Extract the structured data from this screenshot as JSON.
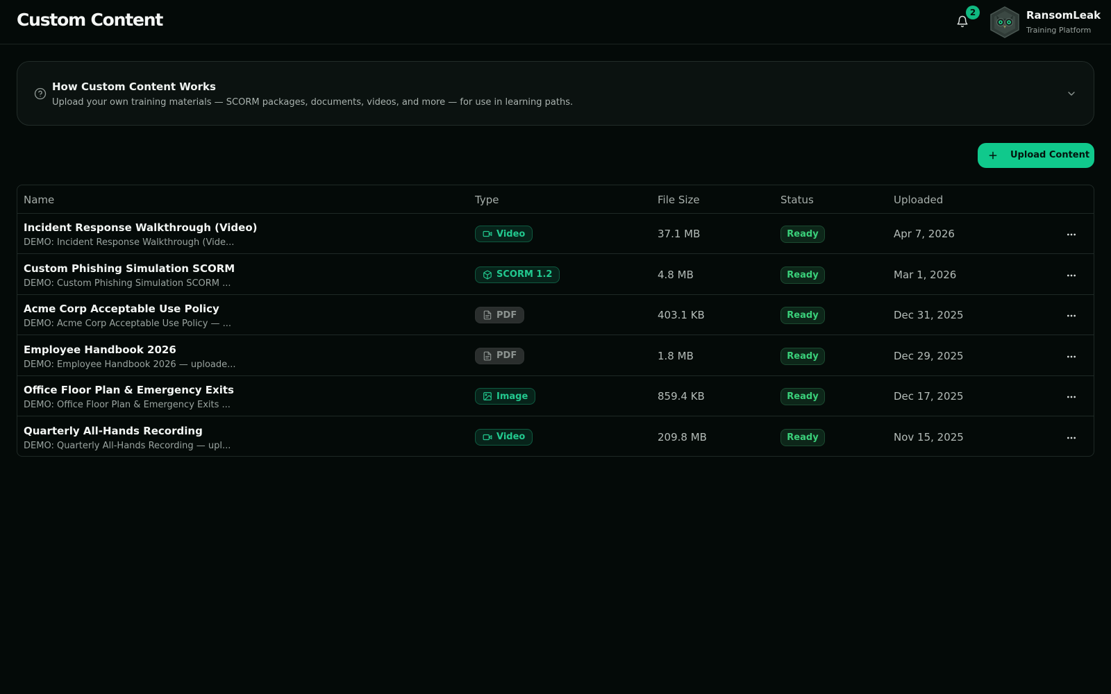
{
  "header": {
    "title": "Custom Content",
    "notification_count": "2",
    "org_name": "RansomLeak",
    "org_subtitle": "Training Platform"
  },
  "info_card": {
    "title": "How Custom Content Works",
    "description": "Upload your own training materials — SCORM packages, documents, videos, and more — for use in learning paths."
  },
  "toolbar": {
    "upload_label": "Upload Content"
  },
  "table": {
    "columns": [
      "Name",
      "Type",
      "File Size",
      "Status",
      "Uploaded"
    ],
    "rows": [
      {
        "name": "Incident Response Walkthrough (Video)",
        "description": "DEMO: Incident Response Walkthrough (Vide...",
        "type": "Video",
        "type_icon": "video-icon",
        "size": "37.1 MB",
        "status": "Ready",
        "uploaded": "Apr 7, 2026"
      },
      {
        "name": "Custom Phishing Simulation SCORM",
        "description": "DEMO: Custom Phishing Simulation SCORM ...",
        "type": "SCORM 1.2",
        "type_icon": "package-icon",
        "size": "4.8 MB",
        "status": "Ready",
        "uploaded": "Mar 1, 2026"
      },
      {
        "name": "Acme Corp Acceptable Use Policy",
        "description": "DEMO: Acme Corp Acceptable Use Policy — ...",
        "type": "PDF",
        "type_icon": "document-icon",
        "size": "403.1 KB",
        "status": "Ready",
        "uploaded": "Dec 31, 2025"
      },
      {
        "name": "Employee Handbook 2026",
        "description": "DEMO: Employee Handbook 2026 — uploade...",
        "type": "PDF",
        "type_icon": "document-icon",
        "size": "1.8 MB",
        "status": "Ready",
        "uploaded": "Dec 29, 2025"
      },
      {
        "name": "Office Floor Plan & Emergency Exits",
        "description": "DEMO: Office Floor Plan & Emergency Exits ...",
        "type": "Image",
        "type_icon": "image-icon",
        "size": "859.4 KB",
        "status": "Ready",
        "uploaded": "Dec 17, 2025"
      },
      {
        "name": "Quarterly All-Hands Recording",
        "description": "DEMO: Quarterly All-Hands Recording — upl...",
        "type": "Video",
        "type_icon": "video-icon",
        "size": "209.8 MB",
        "status": "Ready",
        "uploaded": "Nov 15, 2025"
      }
    ]
  },
  "colors": {
    "background": "#040a08",
    "accent": "#10c98c",
    "status_ready": "#3ad07a",
    "type_green": "#22c98f",
    "type_grey": "#8c9390"
  }
}
